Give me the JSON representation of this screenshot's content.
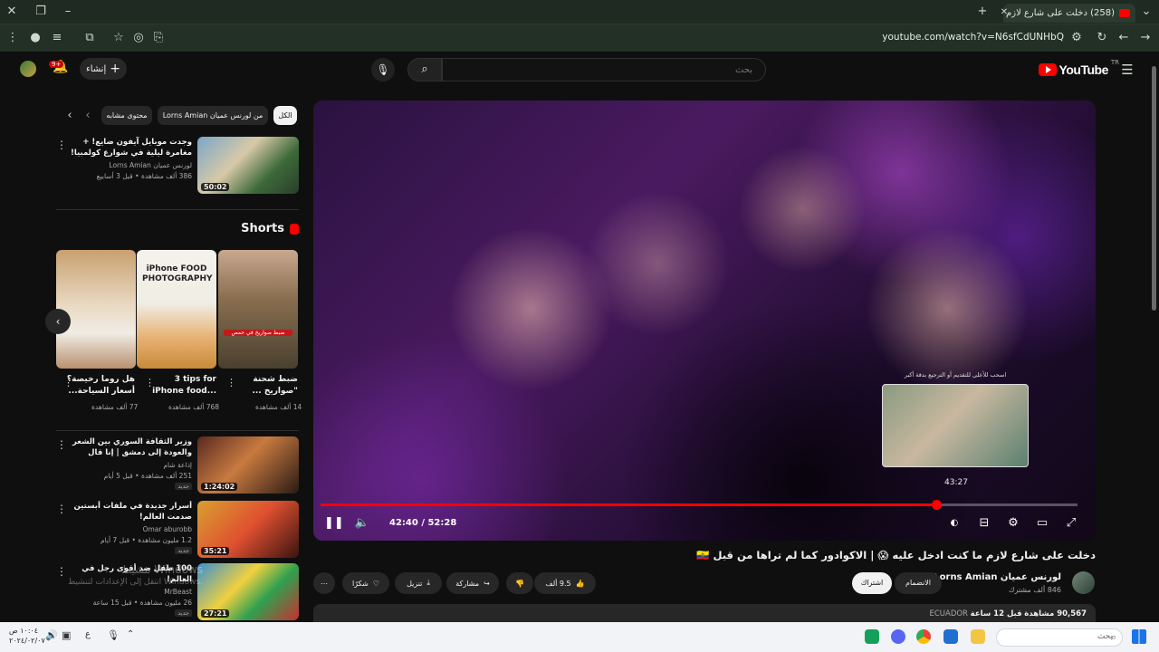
{
  "browser": {
    "tab_title": "(258) دخلت على شارع لازم ...",
    "url": "youtube.com/watch?v=N6sfCdUNHbQ"
  },
  "header": {
    "logo_text": "YouTube",
    "logo_region": "TR",
    "search_placeholder": "بحث",
    "create_label": "إنشاء",
    "notifications_badge": "9+"
  },
  "chips": [
    "الكل",
    "من لورنس عميان Lorns Amian",
    "محتوى مشابه"
  ],
  "related_top": {
    "title": "وجدت موبايل آيفون ضايع! + مغامرة ليلية في شوارع كولمبيا! 🇨🇴",
    "channel": "لورنس عميان Lorns Amian",
    "meta": "386 ألف مشاهدة • قبل 3 أسابيع",
    "duration": "50:02"
  },
  "shorts": {
    "heading": "Shorts",
    "items": [
      {
        "title": "ضبط شحنة \"صواريخ ...",
        "views": "14 ألف مشاهدة",
        "overlay": "ضبط صواريخ في حمص"
      },
      {
        "title": "3 tips for iPhone food...",
        "views": "768 ألف مشاهدة",
        "overlay": "iPhone FOOD PHOTOGRAPHY"
      },
      {
        "title": "هل روما رخيصة؟ أسعار السياحة...",
        "views": "77 ألف مشاهدة",
        "overlay": ""
      }
    ]
  },
  "related": [
    {
      "title": "وزير الثقافة السوري بين الشعر والعودة إلى دمشق | إنا قال",
      "channel": "إذاعة شام",
      "meta": "251 ألف مشاهدة • قبل 5 أيام",
      "badge": "جديد",
      "duration": "1:24:02"
    },
    {
      "title": "أسرار جديدة في ملفات أبستين صدمت العالم!",
      "channel": "Omar aburobb",
      "meta": "1.2 مليون مشاهدة • قبل 7 أيام",
      "badge": "جديد",
      "duration": "35:21"
    },
    {
      "title": "100 طفل ضد أقوى رجل في العالم!",
      "channel": "MrBeast",
      "meta": "26 مليون مشاهدة • قبل 15 ساعة",
      "badge": "جديد",
      "duration": "27:21"
    }
  ],
  "player": {
    "current_time": "42:40",
    "total_time": "52:28",
    "hover_time": "43:27",
    "progress_fraction": 0.813,
    "preview_caption": "اسحب للأعلى للتقديم أو الترجيع بدقة أكبر"
  },
  "video": {
    "title": "دخلت على شارع لازم ما كنت ادخل عليه 😱 | الاكوادور كما لم تراها من قبل 🇪🇨",
    "channel": "لورنس عميان Lorns Amian",
    "subscribers": "846 ألف مشترك",
    "join_label": "الانضمام",
    "subscribe_label": "اشتراك",
    "likes": "9.5 ألف",
    "share_label": "مشاركة",
    "download_label": "تنزيل",
    "thanks_label": "شكرًا",
    "views": "90,567 مشاهدة",
    "date": "قبل 12 ساعة",
    "tag": "ECUADOR"
  },
  "os": {
    "watermark_title": "تنشيط Windows",
    "watermark_sub": "انتقل إلى الإعدادات لتنشيط Windows.",
    "search_placeholder": "بحث",
    "time": "١٠:٠٤ ص",
    "date": "٢٠٢٤/٠٢/٠٧",
    "lang": "ع"
  }
}
